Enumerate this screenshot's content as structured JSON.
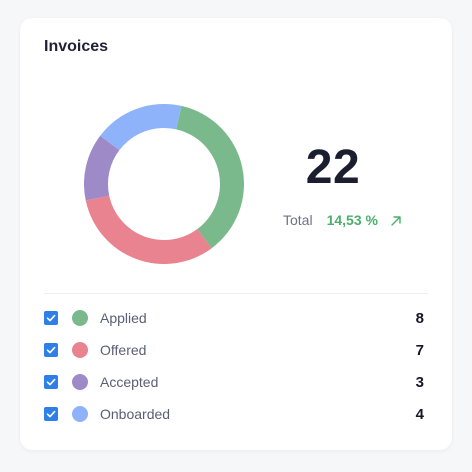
{
  "card": {
    "title": "Invoices",
    "total_count": "22",
    "total_label": "Total",
    "total_change": "14,53 %",
    "trend_icon": "arrow-up-right-icon",
    "trend_color": "#4caf6a"
  },
  "chart_data": {
    "type": "pie",
    "categories": [
      "Applied",
      "Offered",
      "Accepted",
      "Onboarded"
    ],
    "values": [
      8,
      7,
      3,
      4
    ],
    "colors": [
      "#79b98c",
      "#e8838f",
      "#9f8ac8",
      "#8fb3fb"
    ],
    "hole": "donut"
  },
  "legend": {
    "items": [
      {
        "label": "Applied",
        "value": "8",
        "color": "#79b98c",
        "checked": true
      },
      {
        "label": "Offered",
        "value": "7",
        "color": "#e8838f",
        "checked": true
      },
      {
        "label": "Accepted",
        "value": "3",
        "color": "#9f8ac8",
        "checked": true
      },
      {
        "label": "Onboarded",
        "value": "4",
        "color": "#8fb3fb",
        "checked": true
      }
    ]
  }
}
